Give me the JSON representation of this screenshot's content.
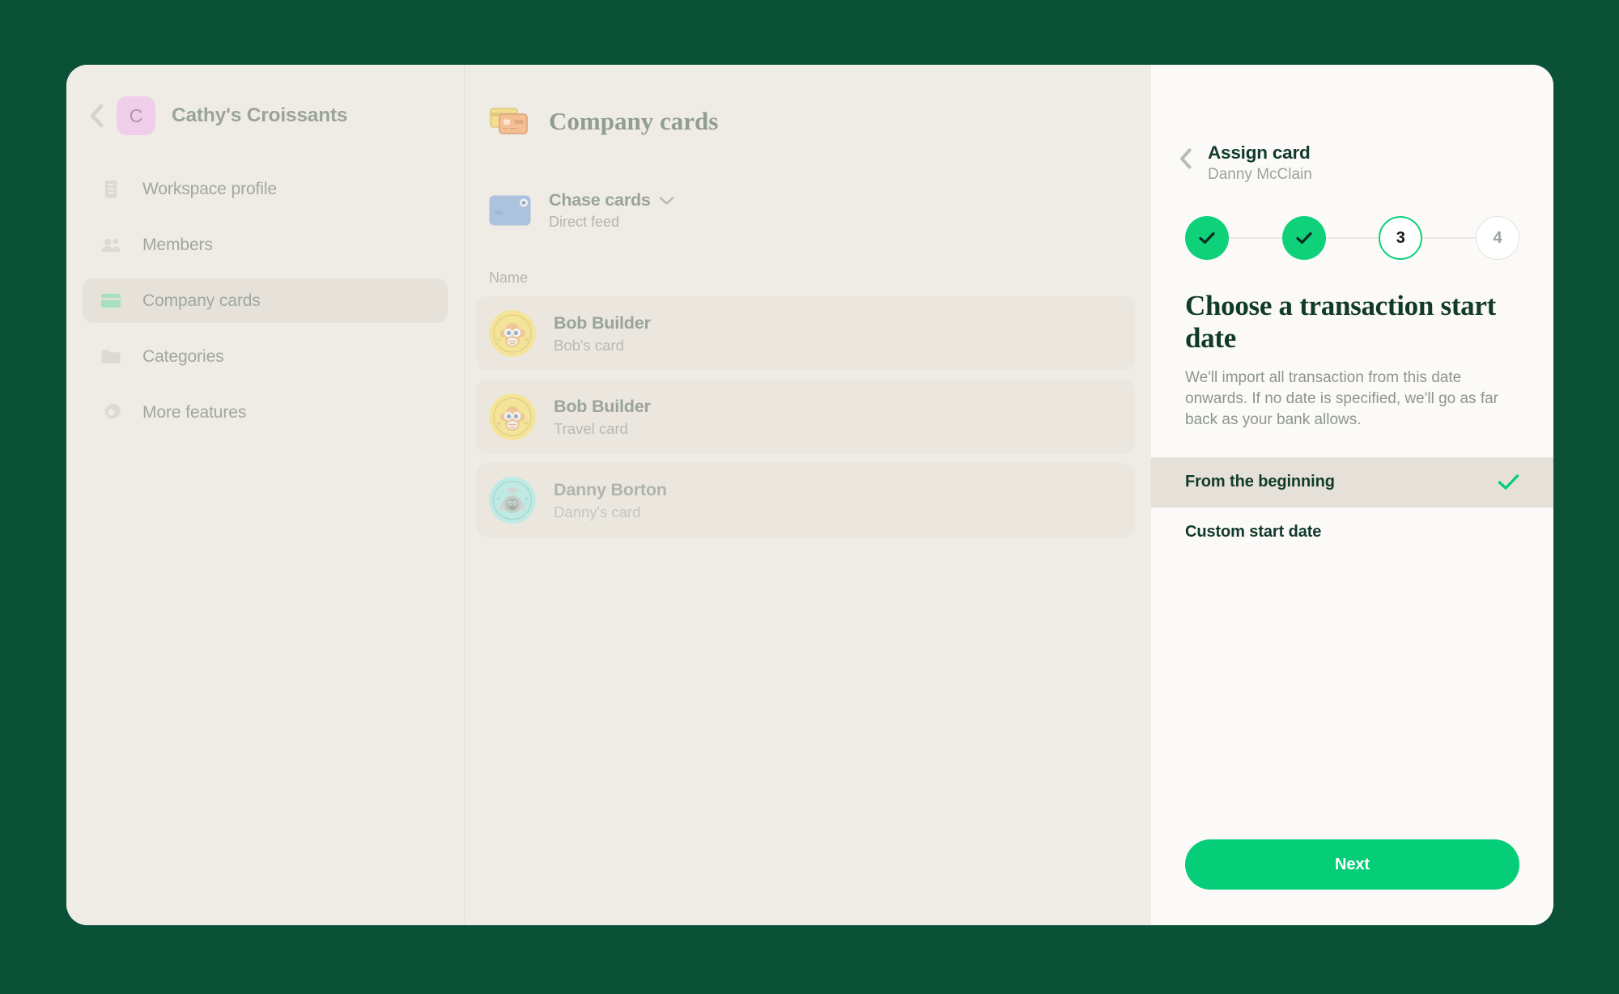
{
  "theme": {
    "page_background": "#0a5138",
    "window_background": "#efece5",
    "drawer_background": "#fbfaf8",
    "accent_green": "#05cd78",
    "step_green": "#0ed17a",
    "title_dark": "#123a2b",
    "muted_text": "#9aa49b"
  },
  "sidebar": {
    "back_icon": "chevron-left-icon",
    "workspace_avatar_letter": "C",
    "workspace_name": "Cathy's Croissants",
    "items": [
      {
        "label": "Workspace profile",
        "icon": "building-icon",
        "active": false
      },
      {
        "label": "Members",
        "icon": "people-icon",
        "active": false
      },
      {
        "label": "Company cards",
        "icon": "credit-card-icon",
        "active": true
      },
      {
        "label": "Categories",
        "icon": "folder-icon",
        "active": false
      },
      {
        "label": "More features",
        "icon": "gear-icon",
        "active": false
      }
    ]
  },
  "main": {
    "header_icon": "two-cards-icon",
    "title": "Company cards",
    "feed": {
      "icon": "blue-card-icon",
      "name": "Chase cards",
      "chevron": "chevron-down-icon",
      "subtitle": "Direct feed"
    },
    "column_header": "Name",
    "rows": [
      {
        "name": "Bob Builder",
        "sub": "Bob's card",
        "avatar": "monkey-avatar-yellow",
        "dimmed": false
      },
      {
        "name": "Bob Builder",
        "sub": "Travel card",
        "avatar": "monkey-avatar-yellow",
        "dimmed": false
      },
      {
        "name": "Danny Borton",
        "sub": "Danny's card",
        "avatar": "astronaut-avatar-cyan",
        "dimmed": true
      }
    ]
  },
  "drawer": {
    "back_icon": "chevron-left-icon",
    "title": "Assign card",
    "subtitle": "Danny McClain",
    "steps": [
      {
        "label": "1",
        "state": "done",
        "icon": "check-icon"
      },
      {
        "label": "2",
        "state": "done",
        "icon": "check-icon"
      },
      {
        "label": "3",
        "state": "current"
      },
      {
        "label": "4",
        "state": "todo"
      }
    ],
    "heading": "Choose a transaction start date",
    "description": "We'll import all transaction from this date onwards. If no date is specified, we'll go as far back as your bank allows.",
    "options": [
      {
        "label": "From the beginning",
        "selected": true,
        "check_icon": "check-icon"
      },
      {
        "label": "Custom start date",
        "selected": false
      }
    ],
    "next_label": "Next"
  }
}
